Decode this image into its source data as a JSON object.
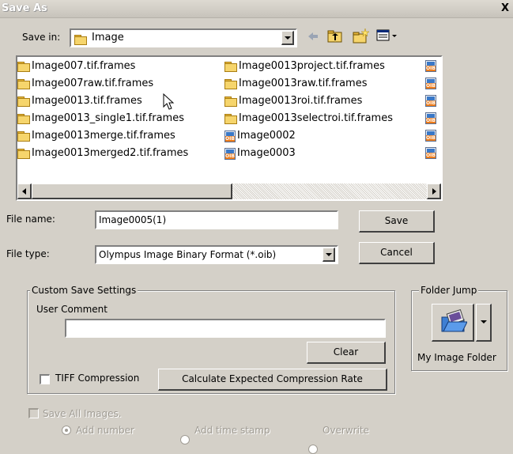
{
  "window": {
    "title": "Save As",
    "close_glyph": "X"
  },
  "save_in": {
    "label": "Save in:",
    "value": "Image"
  },
  "toolbar": {
    "back_icon": "back-arrow-icon",
    "up_icon": "up-folder-icon",
    "new_folder_icon": "new-folder-icon",
    "views_icon": "views-menu-icon"
  },
  "files": {
    "col1": [
      "Image007.tif.frames",
      "Image007raw.tif.frames",
      "Image0013.tif.frames",
      "Image0013_single1.tif.frames",
      "Image0013merge.tif.frames",
      "Image0013merged2.tif.frames"
    ],
    "col2": [
      "Image0013project.tif.frames",
      "Image0013raw.tif.frames",
      "Image0013roi.tif.frames",
      "Image0013selectroi.tif.frames",
      "Image0002",
      "Image0003"
    ],
    "col2_types": [
      "folder",
      "folder",
      "folder",
      "folder",
      "oib",
      "oib"
    ],
    "col3_count": 6
  },
  "file_name": {
    "label": "File name:",
    "value": "Image0005(1)"
  },
  "file_type": {
    "label": "File type:",
    "value": "Olympus Image Binary Format (*.oib)"
  },
  "buttons": {
    "save": "Save",
    "cancel": "Cancel",
    "clear": "Clear",
    "calc": "Calculate Expected Compression Rate"
  },
  "custom": {
    "caption": "Custom Save Settings",
    "user_comment_label": "User Comment",
    "user_comment_value": "",
    "tiff_label": "TIFF Compression",
    "tiff_checked": false
  },
  "folder_jump": {
    "caption": "Folder Jump",
    "label": "My Image Folder"
  },
  "save_all": {
    "label": "Save All Images.",
    "options": [
      "Add number",
      "Add time stamp",
      "Overwrite"
    ],
    "selected": 0
  }
}
